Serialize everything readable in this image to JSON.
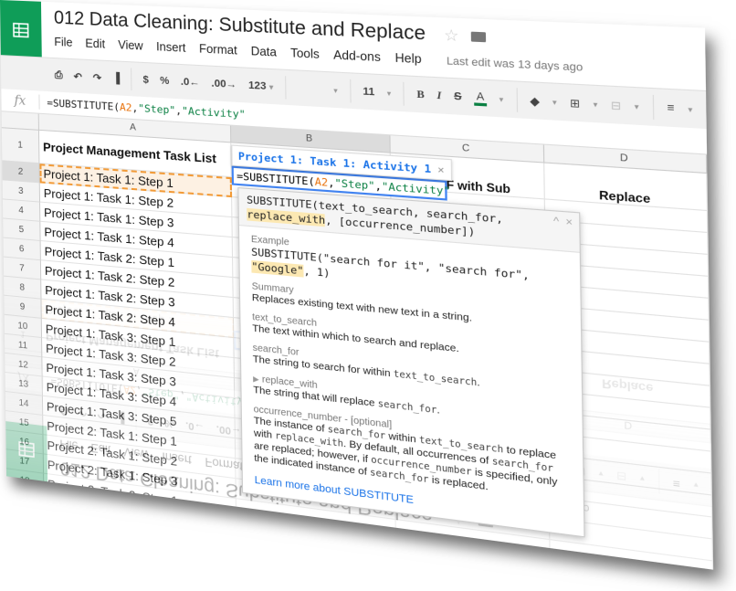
{
  "app": {
    "doc_title": "012 Data Cleaning: Substitute and Replace",
    "star_icon": "star-icon",
    "folder_icon": "folder-icon",
    "logo_icon": "sheets-logo-icon"
  },
  "menu": {
    "items": [
      "File",
      "Edit",
      "View",
      "Insert",
      "Format",
      "Data",
      "Tools",
      "Add-ons",
      "Help"
    ],
    "last_edit": "Last edit was 13 days ago"
  },
  "toolbar": {
    "print_icon": "⎙",
    "undo_icon": "↶",
    "redo_icon": "↷",
    "paint_format_icon": "▐",
    "currency": "$",
    "percent": "%",
    "decrease_decimal": ".0←",
    "increase_decimal": ".00→",
    "more_formats": "123",
    "font_family": "",
    "font_size": "11",
    "bold": "B",
    "italic": "I",
    "strikethrough": "S",
    "text_color": "A",
    "text_color_value": "#0b8043",
    "fill_color_icon": "◆",
    "borders_icon": "⊞",
    "merge_icon": "⊟",
    "align_icon": "≡",
    "caret": "▾"
  },
  "formula_bar": {
    "fx_label": "fx",
    "formula_prefix": "=SUBSTITUTE(",
    "formula_ref": "A2",
    "formula_sep1": ",",
    "formula_str1": "\"Step\"",
    "formula_sep2": ",",
    "formula_str2": "\"Activity\""
  },
  "grid": {
    "columns": [
      "A",
      "B",
      "C",
      "D"
    ],
    "selected_column": "B",
    "header_row": {
      "A": "Project Management Task List",
      "B": "",
      "C": "IF with Sub",
      "D": "Replace"
    },
    "rows": [
      {
        "num": "2",
        "A": "Project 1: Task 1: Step 1"
      },
      {
        "num": "3",
        "A": "Project 1: Task 1: Step 2"
      },
      {
        "num": "4",
        "A": "Project 1: Task 1: Step 3"
      },
      {
        "num": "5",
        "A": "Project 1: Task 1: Step 4"
      },
      {
        "num": "6",
        "A": "Project 1: Task 2: Step 1"
      },
      {
        "num": "7",
        "A": "Project 1: Task 2: Step 2"
      },
      {
        "num": "8",
        "A": "Project 1: Task 2: Step 3"
      },
      {
        "num": "9",
        "A": "Project 1: Task 2: Step 4"
      },
      {
        "num": "10",
        "A": "Project 1: Task 3: Step 1"
      },
      {
        "num": "11",
        "A": "Project 1: Task 3: Step 2"
      },
      {
        "num": "12",
        "A": "Project 1: Task 3: Step 3"
      },
      {
        "num": "13",
        "A": "Project 1: Task 3: Step 4"
      },
      {
        "num": "14",
        "A": "Project 1: Task 3: Step 5"
      },
      {
        "num": "15",
        "A": "Project 2: Task 1: Step 1"
      },
      {
        "num": "16",
        "A": "Project 2: Task 1: Step 2"
      },
      {
        "num": "17",
        "A": "Project 2: Task 1: Step 3"
      },
      {
        "num": "18",
        "A": "Project 2: Task 2: Step 1"
      }
    ],
    "active_cell": "B2",
    "copied_cell": "A2"
  },
  "edit": {
    "prefix": "=SUBSTITUTE(",
    "ref": "A2",
    "sep1": ",",
    "str1": "\"Step\"",
    "sep2": ",",
    "str2": "\"Activity\"",
    "preview": "Project 1: Task 1: Activity 1",
    "preview_close": "×"
  },
  "help": {
    "sig_pre": "SUBSTITUTE(text_to_search, search_for,",
    "sig_hl": "replace_with",
    "sig_post": ", [occurrence_number])",
    "collapse_icon": "^",
    "close_icon": "×",
    "example_label": "Example",
    "example_line1": "SUBSTITUTE(\"search for it\", \"search for\",",
    "example_hl": "\"Google\"",
    "example_rest": ", 1)",
    "summary_label": "Summary",
    "summary_text": "Replaces existing text with new text in a string.",
    "args": [
      {
        "name": "text_to_search",
        "desc": "The text within which to search and replace."
      },
      {
        "name": "search_for",
        "desc_pre": "The string to search for within ",
        "desc_code": "text_to_search",
        "desc_post": "."
      },
      {
        "name": "replace_with",
        "desc_pre": "The string that will replace ",
        "desc_code": "search_for",
        "desc_post": "."
      },
      {
        "name": "occurrence_number - [optional]"
      }
    ],
    "occ_t1": "The instance of ",
    "occ_c1": "search_for",
    "occ_t2": " within ",
    "occ_c2": "text_to_search",
    "occ_t3": " to replace with ",
    "occ_c3": "replace_with",
    "occ_t4": ". By default, all occurrences of ",
    "occ_c4": "search_for",
    "occ_t5": " are replaced; however, if ",
    "occ_c5": "occurrence_number",
    "occ_t6": " is specified, only the indicated instance of ",
    "occ_c6": "search_for",
    "occ_t7": " is replaced.",
    "learn_more": "Learn more about SUBSTITUTE"
  }
}
